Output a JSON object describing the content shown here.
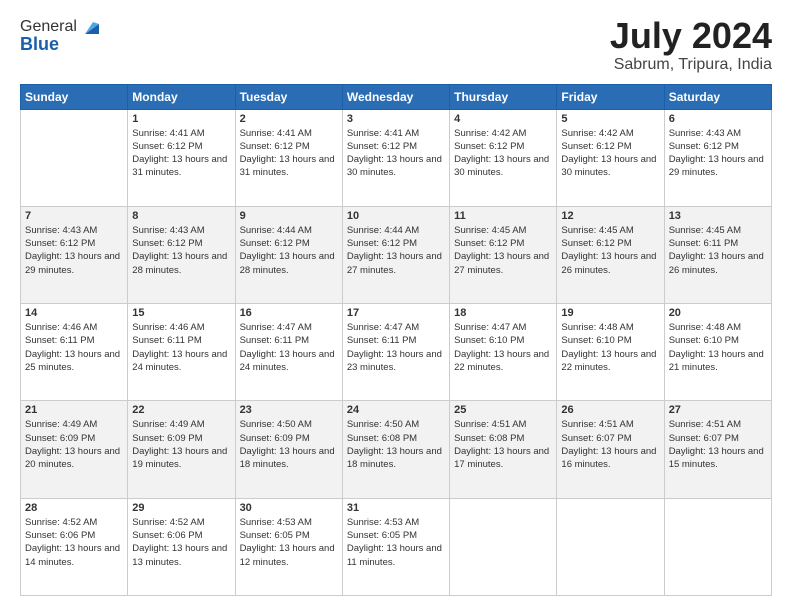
{
  "header": {
    "logo": {
      "line1": "General",
      "line2": "Blue"
    },
    "month": "July 2024",
    "location": "Sabrum, Tripura, India"
  },
  "columns": [
    "Sunday",
    "Monday",
    "Tuesday",
    "Wednesday",
    "Thursday",
    "Friday",
    "Saturday"
  ],
  "rows": [
    [
      {
        "day": "",
        "sunrise": "",
        "sunset": "",
        "daylight": ""
      },
      {
        "day": "1",
        "sunrise": "Sunrise: 4:41 AM",
        "sunset": "Sunset: 6:12 PM",
        "daylight": "Daylight: 13 hours and 31 minutes."
      },
      {
        "day": "2",
        "sunrise": "Sunrise: 4:41 AM",
        "sunset": "Sunset: 6:12 PM",
        "daylight": "Daylight: 13 hours and 31 minutes."
      },
      {
        "day": "3",
        "sunrise": "Sunrise: 4:41 AM",
        "sunset": "Sunset: 6:12 PM",
        "daylight": "Daylight: 13 hours and 30 minutes."
      },
      {
        "day": "4",
        "sunrise": "Sunrise: 4:42 AM",
        "sunset": "Sunset: 6:12 PM",
        "daylight": "Daylight: 13 hours and 30 minutes."
      },
      {
        "day": "5",
        "sunrise": "Sunrise: 4:42 AM",
        "sunset": "Sunset: 6:12 PM",
        "daylight": "Daylight: 13 hours and 30 minutes."
      },
      {
        "day": "6",
        "sunrise": "Sunrise: 4:43 AM",
        "sunset": "Sunset: 6:12 PM",
        "daylight": "Daylight: 13 hours and 29 minutes."
      }
    ],
    [
      {
        "day": "7",
        "sunrise": "Sunrise: 4:43 AM",
        "sunset": "Sunset: 6:12 PM",
        "daylight": "Daylight: 13 hours and 29 minutes."
      },
      {
        "day": "8",
        "sunrise": "Sunrise: 4:43 AM",
        "sunset": "Sunset: 6:12 PM",
        "daylight": "Daylight: 13 hours and 28 minutes."
      },
      {
        "day": "9",
        "sunrise": "Sunrise: 4:44 AM",
        "sunset": "Sunset: 6:12 PM",
        "daylight": "Daylight: 13 hours and 28 minutes."
      },
      {
        "day": "10",
        "sunrise": "Sunrise: 4:44 AM",
        "sunset": "Sunset: 6:12 PM",
        "daylight": "Daylight: 13 hours and 27 minutes."
      },
      {
        "day": "11",
        "sunrise": "Sunrise: 4:45 AM",
        "sunset": "Sunset: 6:12 PM",
        "daylight": "Daylight: 13 hours and 27 minutes."
      },
      {
        "day": "12",
        "sunrise": "Sunrise: 4:45 AM",
        "sunset": "Sunset: 6:12 PM",
        "daylight": "Daylight: 13 hours and 26 minutes."
      },
      {
        "day": "13",
        "sunrise": "Sunrise: 4:45 AM",
        "sunset": "Sunset: 6:11 PM",
        "daylight": "Daylight: 13 hours and 26 minutes."
      }
    ],
    [
      {
        "day": "14",
        "sunrise": "Sunrise: 4:46 AM",
        "sunset": "Sunset: 6:11 PM",
        "daylight": "Daylight: 13 hours and 25 minutes."
      },
      {
        "day": "15",
        "sunrise": "Sunrise: 4:46 AM",
        "sunset": "Sunset: 6:11 PM",
        "daylight": "Daylight: 13 hours and 24 minutes."
      },
      {
        "day": "16",
        "sunrise": "Sunrise: 4:47 AM",
        "sunset": "Sunset: 6:11 PM",
        "daylight": "Daylight: 13 hours and 24 minutes."
      },
      {
        "day": "17",
        "sunrise": "Sunrise: 4:47 AM",
        "sunset": "Sunset: 6:11 PM",
        "daylight": "Daylight: 13 hours and 23 minutes."
      },
      {
        "day": "18",
        "sunrise": "Sunrise: 4:47 AM",
        "sunset": "Sunset: 6:10 PM",
        "daylight": "Daylight: 13 hours and 22 minutes."
      },
      {
        "day": "19",
        "sunrise": "Sunrise: 4:48 AM",
        "sunset": "Sunset: 6:10 PM",
        "daylight": "Daylight: 13 hours and 22 minutes."
      },
      {
        "day": "20",
        "sunrise": "Sunrise: 4:48 AM",
        "sunset": "Sunset: 6:10 PM",
        "daylight": "Daylight: 13 hours and 21 minutes."
      }
    ],
    [
      {
        "day": "21",
        "sunrise": "Sunrise: 4:49 AM",
        "sunset": "Sunset: 6:09 PM",
        "daylight": "Daylight: 13 hours and 20 minutes."
      },
      {
        "day": "22",
        "sunrise": "Sunrise: 4:49 AM",
        "sunset": "Sunset: 6:09 PM",
        "daylight": "Daylight: 13 hours and 19 minutes."
      },
      {
        "day": "23",
        "sunrise": "Sunrise: 4:50 AM",
        "sunset": "Sunset: 6:09 PM",
        "daylight": "Daylight: 13 hours and 18 minutes."
      },
      {
        "day": "24",
        "sunrise": "Sunrise: 4:50 AM",
        "sunset": "Sunset: 6:08 PM",
        "daylight": "Daylight: 13 hours and 18 minutes."
      },
      {
        "day": "25",
        "sunrise": "Sunrise: 4:51 AM",
        "sunset": "Sunset: 6:08 PM",
        "daylight": "Daylight: 13 hours and 17 minutes."
      },
      {
        "day": "26",
        "sunrise": "Sunrise: 4:51 AM",
        "sunset": "Sunset: 6:07 PM",
        "daylight": "Daylight: 13 hours and 16 minutes."
      },
      {
        "day": "27",
        "sunrise": "Sunrise: 4:51 AM",
        "sunset": "Sunset: 6:07 PM",
        "daylight": "Daylight: 13 hours and 15 minutes."
      }
    ],
    [
      {
        "day": "28",
        "sunrise": "Sunrise: 4:52 AM",
        "sunset": "Sunset: 6:06 PM",
        "daylight": "Daylight: 13 hours and 14 minutes."
      },
      {
        "day": "29",
        "sunrise": "Sunrise: 4:52 AM",
        "sunset": "Sunset: 6:06 PM",
        "daylight": "Daylight: 13 hours and 13 minutes."
      },
      {
        "day": "30",
        "sunrise": "Sunrise: 4:53 AM",
        "sunset": "Sunset: 6:05 PM",
        "daylight": "Daylight: 13 hours and 12 minutes."
      },
      {
        "day": "31",
        "sunrise": "Sunrise: 4:53 AM",
        "sunset": "Sunset: 6:05 PM",
        "daylight": "Daylight: 13 hours and 11 minutes."
      },
      {
        "day": "",
        "sunrise": "",
        "sunset": "",
        "daylight": ""
      },
      {
        "day": "",
        "sunrise": "",
        "sunset": "",
        "daylight": ""
      },
      {
        "day": "",
        "sunrise": "",
        "sunset": "",
        "daylight": ""
      }
    ]
  ]
}
